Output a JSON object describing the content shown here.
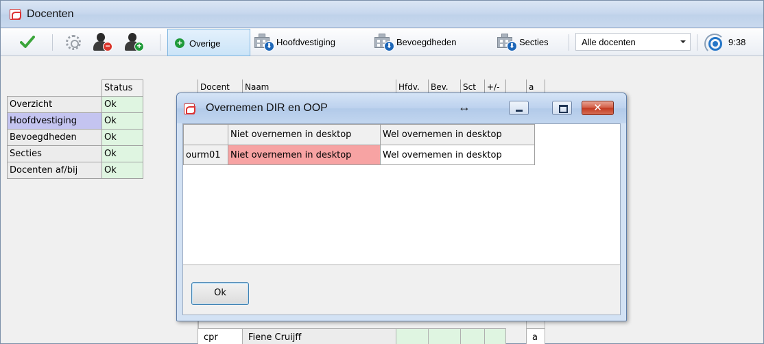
{
  "window": {
    "title": "Docenten",
    "icon": "app-logo-icon"
  },
  "toolbar": {
    "confirm_icon": "checkmark-icon",
    "settings_icon": "gear-icon",
    "remove_user_icon": "remove-user-icon",
    "add_user_icon": "add-user-icon",
    "overige_label": "Overige",
    "hoofdvestiging_label": "Hoofdvestiging",
    "bevoegdheden_label": "Bevoegdheden",
    "secties_label": "Secties",
    "filter_selected": "Alle docenten",
    "time": "9:38"
  },
  "status_panel": {
    "header": "Status",
    "rows": [
      {
        "name": "Overzicht",
        "status": "Ok"
      },
      {
        "name": "Hoofdvestiging",
        "status": "Ok"
      },
      {
        "name": "Bevoegdheden",
        "status": "Ok"
      },
      {
        "name": "Secties",
        "status": "Ok"
      },
      {
        "name": "Docenten af/bij",
        "status": "Ok"
      }
    ]
  },
  "grid": {
    "headers": [
      "Docent",
      "Naam",
      "Hfdv.",
      "Bev.",
      "Sct",
      "+/-",
      "a"
    ],
    "rows": [
      {
        "docent": "cpr",
        "naam": "Fiene Cruijff",
        "a": "a"
      }
    ]
  },
  "dialog": {
    "title": "Overnemen DIR en OOP",
    "resize_glyph": "↔",
    "close_glyph": "✕",
    "columns": [
      "",
      "Niet overnemen in desktop",
      "Wel overnemen in desktop"
    ],
    "rows": [
      {
        "id": "ourm01",
        "niet": "Niet overnemen in desktop",
        "wel": "Wel overnemen in desktop"
      }
    ],
    "ok_label": "Ok",
    "colors": {
      "selected_cell": "#f7a3a3",
      "title_bar": "#c2d6ef"
    }
  },
  "colors": {
    "status_ok": "#dff5e1",
    "selected_row": "#c4c4f0",
    "accent": "#1e67b8"
  }
}
